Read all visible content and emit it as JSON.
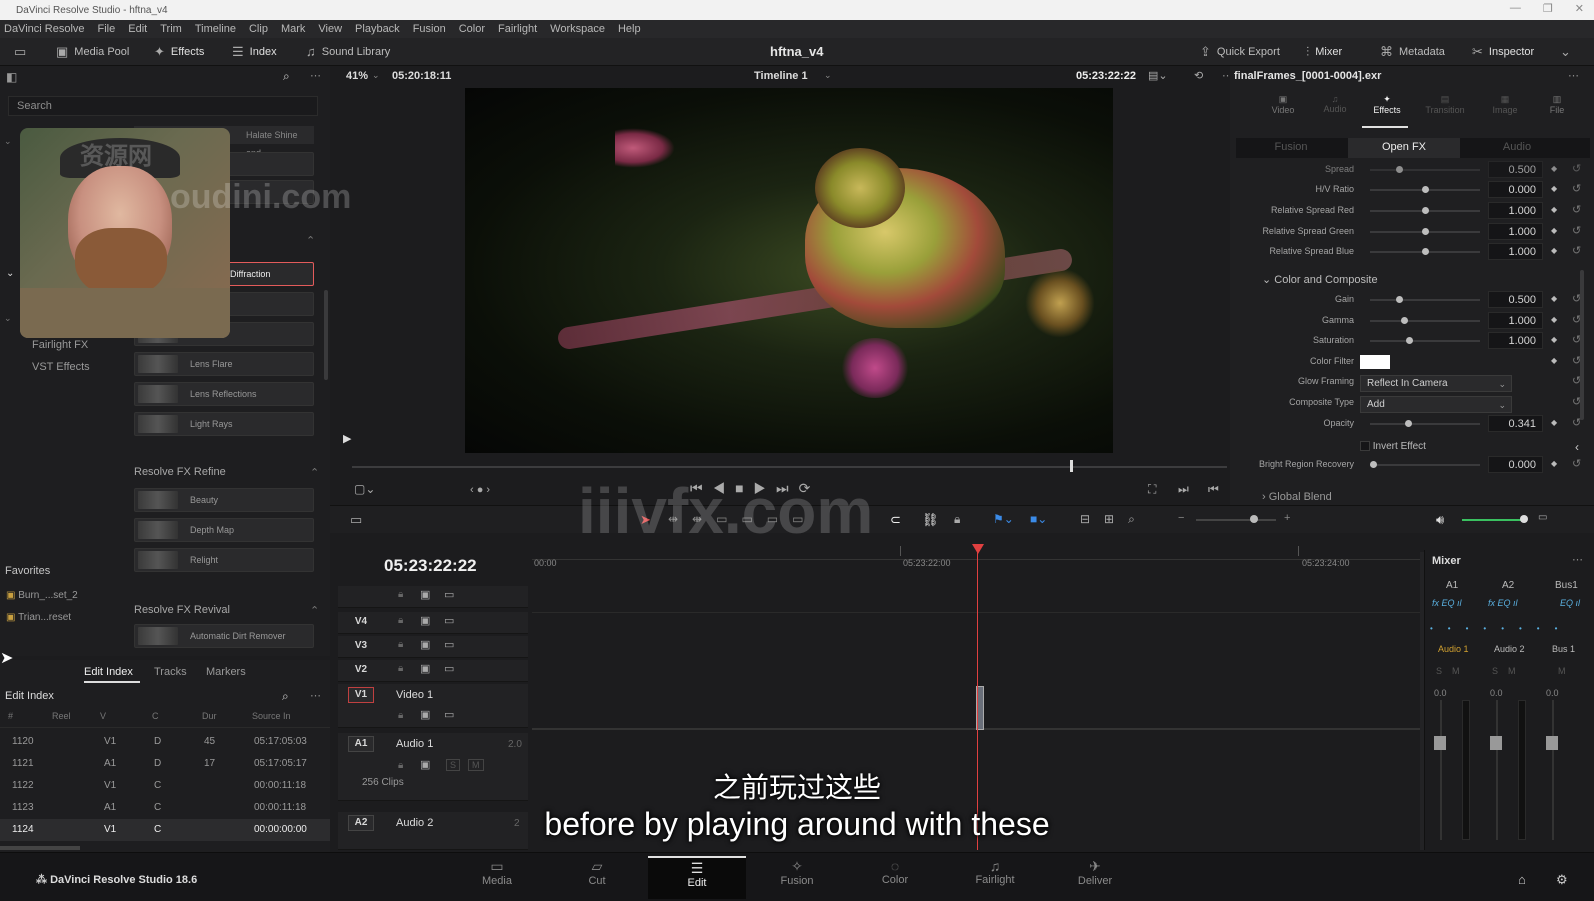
{
  "window": {
    "title": "DaVinci Resolve Studio - hftna_v4"
  },
  "menu": [
    "DaVinci Resolve",
    "File",
    "Edit",
    "Trim",
    "Timeline",
    "Clip",
    "Mark",
    "View",
    "Playback",
    "Fusion",
    "Color",
    "Fairlight",
    "Workspace",
    "Help"
  ],
  "toolbar": {
    "media_pool": "Media Pool",
    "effects": "Effects",
    "index": "Index",
    "sound_library": "Sound Library",
    "project": "hftna_v4",
    "quick_export": "Quick Export",
    "mixer": "Mixer",
    "metadata": "Metadata",
    "inspector": "Inspector"
  },
  "effects_panel": {
    "search_placeholder": "Search",
    "top_item": "Halate Shine and...",
    "selected": "Diffraction",
    "fairlight_fx": "Fairlight FX",
    "vst_effects": "VST Effects",
    "items_light": [
      "Lens Flare",
      "Lens Reflections",
      "Light Rays"
    ],
    "section_refine": "Resolve FX Refine",
    "items_refine": [
      "Beauty",
      "Depth Map",
      "Relight"
    ],
    "section_revival": "Resolve FX Revival",
    "items_revival": [
      "Automatic Dirt Remover"
    ],
    "favorites": "Favorites",
    "fav_items": [
      "Burn_...set_2",
      "Trian...reset"
    ]
  },
  "viewer": {
    "zoom": "41%",
    "src_tc": "05:20:18:11",
    "timeline_name": "Timeline 1",
    "rec_tc": "05:23:22:22"
  },
  "inspector": {
    "clip": "finalFrames_[0001-0004].exr",
    "tabs": [
      "Video",
      "Audio",
      "Effects",
      "Transition",
      "Image",
      "File"
    ],
    "subtabs": [
      "Fusion",
      "Open FX",
      "Audio"
    ],
    "params": [
      {
        "label": "Spread",
        "value": "0.500",
        "pos": 0.25
      },
      {
        "label": "H/V Ratio",
        "value": "0.000",
        "pos": 0.5
      },
      {
        "label": "Relative Spread Red",
        "value": "1.000",
        "pos": 0.5
      },
      {
        "label": "Relative Spread Green",
        "value": "1.000",
        "pos": 0.5
      },
      {
        "label": "Relative Spread Blue",
        "value": "1.000",
        "pos": 0.5
      }
    ],
    "section_color": "Color and Composite",
    "gain": {
      "label": "Gain",
      "value": "0.500",
      "pos": 0.25
    },
    "gamma": {
      "label": "Gamma",
      "value": "1.000",
      "pos": 0.3
    },
    "saturation": {
      "label": "Saturation",
      "value": "1.000",
      "pos": 0.35
    },
    "color_filter": "Color Filter",
    "glow_framing": {
      "label": "Glow Framing",
      "value": "Reflect In Camera"
    },
    "composite_type": {
      "label": "Composite Type",
      "value": "Add"
    },
    "opacity": {
      "label": "Opacity",
      "value": "0.341",
      "pos": 0.34
    },
    "invert_effect": "Invert Effect",
    "bright_region": {
      "label": "Bright Region Recovery",
      "value": "0.000",
      "pos": 0.0
    },
    "section_global": "Global Blend"
  },
  "timeline": {
    "timecode": "05:23:22:22",
    "ruler": [
      "00:00",
      "05:23:22:00",
      "05:23:24:00"
    ],
    "tracks": [
      {
        "tag": "V4",
        "name": ""
      },
      {
        "tag": "V3",
        "name": ""
      },
      {
        "tag": "V2",
        "name": ""
      },
      {
        "tag": "V1",
        "name": "Video 1"
      }
    ],
    "audio": [
      {
        "tag": "A1",
        "name": "Audio 1",
        "level": "2.0",
        "clips": "256 Clips"
      },
      {
        "tag": "A2",
        "name": "Audio 2",
        "level": "2"
      }
    ]
  },
  "mixer": {
    "title": "Mixer",
    "channels": [
      "A1",
      "A2",
      "Bus1"
    ],
    "names": [
      "Audio 1",
      "Audio 2",
      "Bus 1"
    ],
    "db": [
      "0.0",
      "0.0",
      "0.0"
    ]
  },
  "edit_index": {
    "tabs": [
      "Edit Index",
      "Tracks",
      "Markers"
    ],
    "title": "Edit Index",
    "cols": [
      "#",
      "Reel",
      "V",
      "C",
      "Dur",
      "Source In"
    ],
    "rows": [
      {
        "n": "1120",
        "v": "V1",
        "c": "D",
        "dur": "45",
        "src": "05:17:05:03"
      },
      {
        "n": "1121",
        "v": "A1",
        "c": "D",
        "dur": "17",
        "src": "05:17:05:17"
      },
      {
        "n": "1122",
        "v": "V1",
        "c": "C",
        "dur": "",
        "src": "00:00:11:18"
      },
      {
        "n": "1123",
        "v": "A1",
        "c": "C",
        "dur": "",
        "src": "00:00:11:18"
      },
      {
        "n": "1124",
        "v": "V1",
        "c": "C",
        "dur": "",
        "src": "00:00:00:00"
      }
    ]
  },
  "pages": [
    "Media",
    "Cut",
    "Edit",
    "Fusion",
    "Color",
    "Fairlight",
    "Deliver"
  ],
  "app_name": "DaVinci Resolve Studio 18.6",
  "subtitle": {
    "zh": "之前玩过这些",
    "en": "before by playing around with these"
  },
  "watermarks": {
    "w1": "oudini.com",
    "w2": "iiivfx.com",
    "w3": "资源网"
  }
}
